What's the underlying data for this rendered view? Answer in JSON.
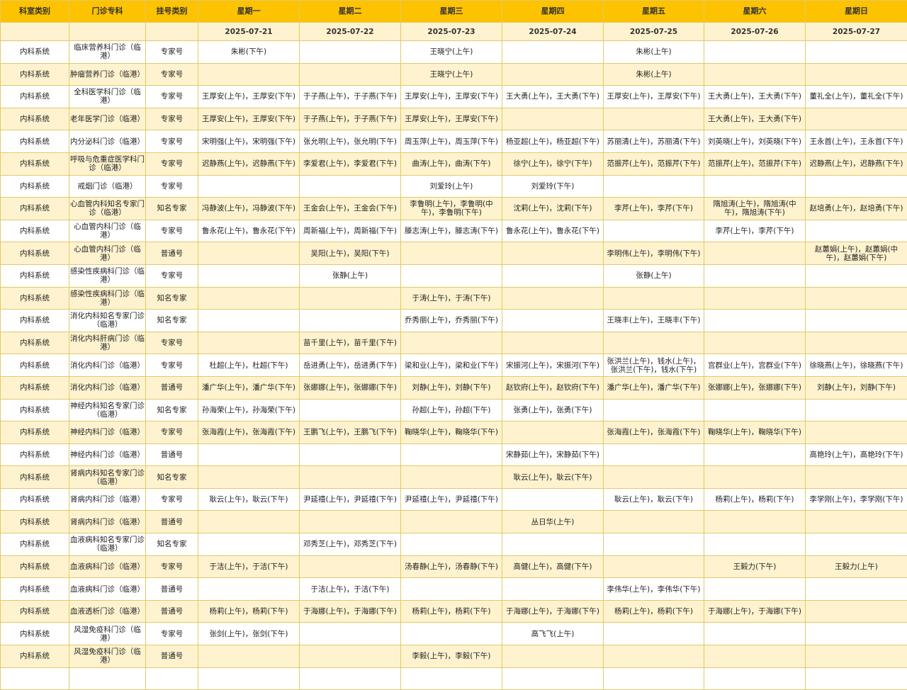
{
  "headers": [
    "科室类别",
    "门诊专科",
    "挂号类别",
    "星期一",
    "星期二",
    "星期三",
    "星期四",
    "星期五",
    "星期六",
    "星期日"
  ],
  "dates": [
    "",
    "",
    "",
    "2025-07-21",
    "2025-07-22",
    "2025-07-23",
    "2025-07-24",
    "2025-07-25",
    "2025-07-26",
    "2025-07-27"
  ],
  "rows": [
    {
      "cat": "内科系统",
      "spec": "临床营养科门诊（临港）",
      "reg": "专家号",
      "days": [
        "朱彬(下午)",
        "",
        "王晓宁(上午)",
        "",
        "朱彬(上午)",
        "",
        ""
      ]
    },
    {
      "cat": "内科系统",
      "spec": "肿瘤营养门诊（临港）",
      "reg": "专家号",
      "days": [
        "",
        "",
        "王晓宁(上午)",
        "",
        "朱彬(上午)",
        "",
        ""
      ]
    },
    {
      "cat": "内科系统",
      "spec": "全科医学科门诊（临港）",
      "reg": "专家号",
      "days": [
        "王厚安(上午)，王厚安(下午)",
        "于子燕(上午)，于子燕(下午)",
        "王厚安(上午)，王厚安(下午)",
        "王大勇(上午)，王大勇(下午)",
        "王厚安(上午)，王厚安(下午)",
        "王大勇(上午)，王大勇(下午)",
        "董礼全(上午)，董礼全(下午)"
      ]
    },
    {
      "cat": "内科系统",
      "spec": "老年医学门诊（临港）",
      "reg": "专家号",
      "days": [
        "王厚安(上午)，王厚安(下午)",
        "于子燕(上午)，于子燕(下午)",
        "王厚安(上午)，王厚安(下午)",
        "",
        "",
        "王大勇(上午)，王大勇(下午)",
        ""
      ]
    },
    {
      "cat": "内科系统",
      "spec": "内分泌科门诊（临港）",
      "reg": "专家号",
      "days": [
        "宋明强(上午)，宋明强(下午)",
        "张允明(上午)，张允明(下午)",
        "周玉萍(上午)，周玉萍(下午)",
        "杨亚超(上午)，杨亚超(下午)",
        "苏丽清(上午)，苏丽清(下午)",
        "刘英晓(上午)，刘英晓(下午)",
        "王永首(上午)，王永首(下午)"
      ]
    },
    {
      "cat": "内科系统",
      "spec": "呼吸与危重症医学科门诊（临港）",
      "reg": "专家号",
      "days": [
        "迟静燕(上午)，迟静燕(下午)",
        "李爱君(上午)，李爱君(下午)",
        "曲涛(上午)，曲涛(下午)",
        "徐宁(上午)，徐宁(下午)",
        "范振芹(上午)，范振芹(下午)",
        "范振芹(上午)，范振芹(下午)",
        "迟静燕(上午)，迟静燕(下午)"
      ]
    },
    {
      "cat": "内科系统",
      "spec": "戒烟门诊（临港）",
      "reg": "专家号",
      "days": [
        "",
        "",
        "刘爱玲(上午)",
        "刘爱玲(下午)",
        "",
        "",
        ""
      ]
    },
    {
      "cat": "内科系统",
      "spec": "心血管内科知名专家门诊（临港）",
      "reg": "知名专家",
      "days": [
        "冯静波(上午)，冯静波(下午)",
        "王金会(上午)，王金会(下午)",
        "李鲁明(上午)，李鲁明(中午)，李鲁明(下午)",
        "沈莉(上午)，沈莉(下午)",
        "李芹(上午)，李芹(下午)",
        "隋旭涛(上午)，隋旭涛(中午)，隋旭涛(下午)",
        "赵培勇(上午)，赵培勇(下午)"
      ]
    },
    {
      "cat": "内科系统",
      "spec": "心血管内科门诊（临港）",
      "reg": "专家号",
      "days": [
        "鲁永花(上午)，鲁永花(下午)",
        "周新福(上午)，周新福(下午)",
        "滕志涛(上午)，滕志涛(下午)",
        "鲁永花(上午)，鲁永花(下午)",
        "",
        "李芹(上午)，李芹(下午)",
        ""
      ]
    },
    {
      "cat": "内科系统",
      "spec": "心血管内科门诊（临港）",
      "reg": "普通号",
      "days": [
        "",
        "吴阳(上午)，吴阳(下午)",
        "",
        "",
        "李明伟(上午)，李明伟(下午)",
        "",
        "赵蕙娟(上午)，赵蕙娟(中午)，赵蕙娟(下午)"
      ]
    },
    {
      "cat": "内科系统",
      "spec": "感染性疾病科门诊（临港）",
      "reg": "专家号",
      "days": [
        "",
        "张静(上午)",
        "",
        "",
        "张静(上午)",
        "",
        ""
      ]
    },
    {
      "cat": "内科系统",
      "spec": "感染性疾病科门诊（临港）",
      "reg": "知名专家",
      "days": [
        "",
        "",
        "于涛(上午)，于涛(下午)",
        "",
        "",
        "",
        ""
      ]
    },
    {
      "cat": "内科系统",
      "spec": "消化内科知名专家门诊（临港）",
      "reg": "知名专家",
      "days": [
        "",
        "",
        "乔秀丽(上午)，乔秀丽(下午)",
        "",
        "王晓丰(上午)，王晓丰(下午)",
        "",
        ""
      ]
    },
    {
      "cat": "内科系统",
      "spec": "消化内科肝病门诊（临港）",
      "reg": "专家号",
      "days": [
        "",
        "苗千里(上午)，苗千里(下午)",
        "",
        "",
        "",
        "",
        ""
      ]
    },
    {
      "cat": "内科系统",
      "spec": "消化内科门诊（临港）",
      "reg": "专家号",
      "days": [
        "杜超(上午)，杜超(下午)",
        "岳进勇(上午)，岳进勇(下午)",
        "梁和业(上午)，梁和业(下午)",
        "宋振河(上午)，宋振河(下午)",
        "张洪兰(上午)，钱水(上午)，张洪兰(下午)，钱水(下午)",
        "宫群业(上午)，宫群业(下午)",
        "徐晓燕(上午)，徐晓燕(下午)"
      ]
    },
    {
      "cat": "内科系统",
      "spec": "消化内科门诊（临港）",
      "reg": "普通号",
      "days": [
        "潘广华(上午)，潘广华(下午)",
        "张娜娜(上午)，张娜娜(下午)",
        "刘静(上午)，刘静(下午)",
        "赵钦府(上午)，赵钦府(下午)",
        "潘广华(上午)，潘广华(下午)",
        "张娜娜(上午)，张娜娜(下午)",
        "刘静(上午)，刘静(下午)"
      ]
    },
    {
      "cat": "内科系统",
      "spec": "神经内科知名专家门诊（临港）",
      "reg": "知名专家",
      "days": [
        "孙海荣(上午)，孙海荣(下午)",
        "",
        "孙超(上午)，孙超(下午)",
        "张勇(上午)，张勇(下午)",
        "",
        "",
        ""
      ]
    },
    {
      "cat": "内科系统",
      "spec": "神经内科门诊（临港）",
      "reg": "专家号",
      "days": [
        "张海霞(上午)，张海霞(下午)",
        "王鹏飞(上午)，王鹏飞(下午)",
        "鞠晓华(上午)，鞠晓华(下午)",
        "",
        "张海霞(上午)，张海霞(下午)",
        "鞠晓华(上午)，鞠晓华(下午)",
        ""
      ]
    },
    {
      "cat": "内科系统",
      "spec": "神经内科门诊（临港）",
      "reg": "普通号",
      "days": [
        "",
        "",
        "",
        "宋静茹(上午)，宋静茹(下午)",
        "",
        "",
        "高艳玲(上午)，高艳玲(下午)"
      ]
    },
    {
      "cat": "内科系统",
      "spec": "肾病内科知名专家门诊（临港）",
      "reg": "知名专家",
      "days": [
        "",
        "",
        "",
        "耿云(上午)，耿云(下午)",
        "",
        "",
        ""
      ]
    },
    {
      "cat": "内科系统",
      "spec": "肾病内科门诊（临港）",
      "reg": "专家号",
      "days": [
        "耿云(上午)，耿云(下午)",
        "尹延禧(上午)，尹延禧(下午)",
        "尹延禧(上午)，尹延禧(下午)",
        "",
        "耿云(上午)，耿云(下午)",
        "杨莉(上午)，杨莉(下午)",
        "李学刚(上午)，李学刚(下午)"
      ]
    },
    {
      "cat": "内科系统",
      "spec": "肾病内科门诊（临港）",
      "reg": "普通号",
      "days": [
        "",
        "",
        "",
        "丛日华(上午)",
        "",
        "",
        ""
      ]
    },
    {
      "cat": "内科系统",
      "spec": "血液病科知名专家门诊（临港）",
      "reg": "知名专家",
      "days": [
        "",
        "邓秀芝(上午)，邓秀芝(下午)",
        "",
        "",
        "",
        "",
        ""
      ]
    },
    {
      "cat": "内科系统",
      "spec": "血液病科门诊（临港）",
      "reg": "专家号",
      "days": [
        "于洁(上午)，于洁(下午)",
        "",
        "汤春静(上午)，汤春静(下午)",
        "高健(上午)，高健(下午)",
        "",
        "王毅力(下午)",
        "王毅力(上午)"
      ]
    },
    {
      "cat": "内科系统",
      "spec": "血液病科门诊（临港）",
      "reg": "普通号",
      "days": [
        "",
        "于洁(上午)，于洁(下午)",
        "",
        "",
        "李伟华(上午)，李伟华(下午)",
        "",
        ""
      ]
    },
    {
      "cat": "内科系统",
      "spec": "血液透析门诊（临港）",
      "reg": "普通号",
      "days": [
        "杨莉(上午)，杨莉(下午)",
        "于海娜(上午)，于海娜(下午)",
        "杨莉(上午)，杨莉(下午)",
        "于海娜(上午)，于海娜(下午)",
        "杨莉(上午)，杨莉(下午)",
        "于海娜(上午)，于海娜(下午)",
        ""
      ]
    },
    {
      "cat": "内科系统",
      "spec": "风湿免疫科门诊（临港）",
      "reg": "专家号",
      "days": [
        "张剑(上午)，张剑(下午)",
        "",
        "",
        "高飞飞(上午)",
        "",
        "",
        ""
      ]
    },
    {
      "cat": "内科系统",
      "spec": "风湿免疫科门诊（临港）",
      "reg": "普通号",
      "days": [
        "",
        "",
        "李毅(上午)，李毅(下午)",
        "",
        "",
        "",
        ""
      ]
    }
  ]
}
